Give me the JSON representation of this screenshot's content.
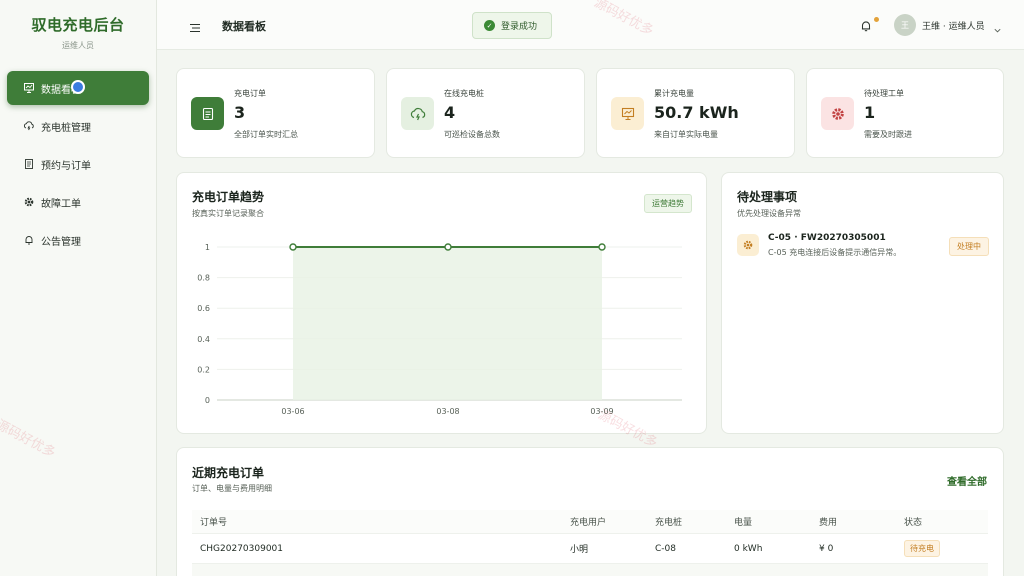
{
  "sidebar": {
    "brand_title": "驭电充电后台",
    "brand_sub": "运维人员",
    "items": [
      {
        "label": "数据看板",
        "icon": "chart-board-icon",
        "active": true
      },
      {
        "label": "充电桩管理",
        "icon": "cloud-charger-icon"
      },
      {
        "label": "预约与订单",
        "icon": "document-list-icon"
      },
      {
        "label": "故障工单",
        "icon": "gear-icon"
      },
      {
        "label": "公告管理",
        "icon": "bell-icon"
      }
    ]
  },
  "header": {
    "title": "数据看板",
    "toast": "登录成功",
    "avatar_initial": "王",
    "user": "王维 · 运维人员"
  },
  "stats": [
    {
      "label": "充电订单",
      "value": "3",
      "note": "全部订单实时汇总",
      "icon": "document-icon",
      "color": "#3f7d39"
    },
    {
      "label": "在线充电桩",
      "value": "4",
      "note": "可巡检设备总数",
      "icon": "cloud-icon",
      "color": "#e5f0e1"
    },
    {
      "label": "累计充电量",
      "value": "50.7 kWh",
      "note": "来自订单实际电量",
      "icon": "chart-icon",
      "color": "#fbeed3"
    },
    {
      "label": "待处理工单",
      "value": "1",
      "note": "需要及时跟进",
      "icon": "gear-icon",
      "color": "#fbe3e3"
    }
  ],
  "trend": {
    "title": "充电订单趋势",
    "subtitle": "按真实订单记录聚合",
    "chip": "运营趋势"
  },
  "chart_data": {
    "type": "area",
    "title": "充电订单趋势",
    "categories": [
      "03-06",
      "03-08",
      "03-09"
    ],
    "values": [
      1,
      1,
      1
    ],
    "ylim": [
      0,
      1
    ],
    "yticks": [
      "0",
      "0.2",
      "0.4",
      "0.6",
      "0.8",
      "1"
    ],
    "grid": true,
    "color": "#3f7d39"
  },
  "todo": {
    "title": "待处理事项",
    "subtitle": "优先处理设备异常",
    "item_title": "C-05 · FW20270305001",
    "item_desc": "C-05 充电连接后设备提示通信异常。",
    "item_status": "处理中"
  },
  "orders": {
    "title": "近期充电订单",
    "subtitle": "订单、电量与费用明细",
    "view_all": "查看全部",
    "columns": [
      "订单号",
      "充电用户",
      "充电桩",
      "电量",
      "费用",
      "状态"
    ],
    "rows": [
      {
        "id": "CHG20270309001",
        "user": "小明",
        "pile": "C-08",
        "energy": "0 kWh",
        "fee": "¥ 0",
        "status": "待充电"
      }
    ]
  },
  "watermark": "源码好优多"
}
